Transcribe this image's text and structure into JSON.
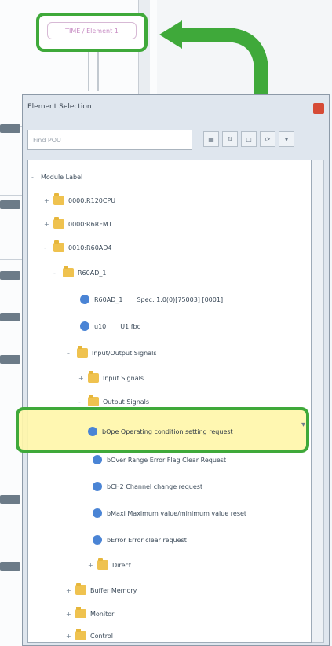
{
  "colors": {
    "highlight_green": "#3fa93a",
    "selection_yellow": "#fff6aa",
    "folder": "#efc24f",
    "signal_icon": "#4a84d5",
    "close_button": "#d64b36"
  },
  "background": {
    "top_field_text": "TIME / Element 1"
  },
  "dialog": {
    "title": "Element Selection",
    "search_placeholder": "Find POU"
  },
  "tree": {
    "root": "Module Label",
    "items": [
      {
        "label": "0000:R120CPU"
      },
      {
        "label": "0000:R6RFM1"
      },
      {
        "label": "0010:R60AD4"
      },
      {
        "label": "R60AD_1"
      },
      {
        "label": "R60AD_1",
        "extra": "Spec: 1.0(0)[75003] [0001]"
      },
      {
        "label": "u10",
        "extra": "U1 fbc"
      },
      {
        "label": "Input/Output Signals"
      },
      {
        "label": "Input Signals"
      },
      {
        "label": "Output Signals"
      },
      {
        "label": "bOver Range Error Flag Clear Request"
      },
      {
        "label": "bCH2 Channel change request"
      },
      {
        "label": "bMaxi Maximum value/minimum value reset"
      },
      {
        "label": "bError Error clear request"
      },
      {
        "label": "Direct"
      },
      {
        "label": "Buffer Memory"
      },
      {
        "label": "Monitor"
      },
      {
        "label": "Control"
      }
    ],
    "selected": "bOpe Operating condition setting request"
  }
}
